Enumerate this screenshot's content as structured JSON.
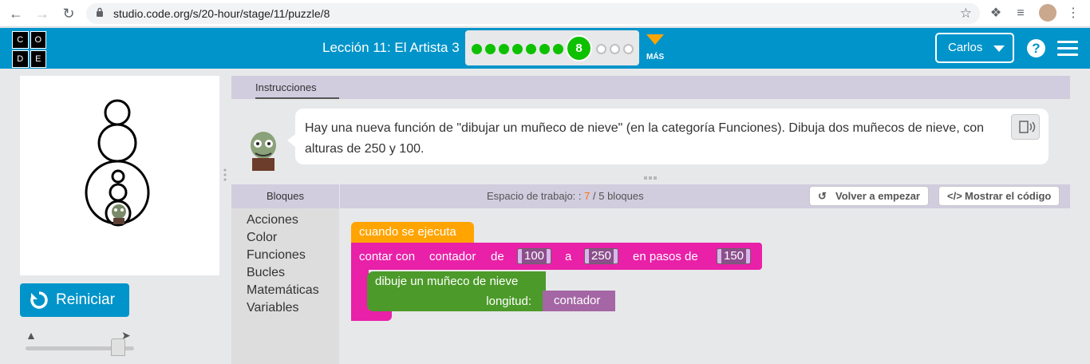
{
  "browser": {
    "url": "studio.code.org/s/20-hour/stage/11/puzzle/8"
  },
  "header": {
    "logo_letters": [
      "C",
      "O",
      "D",
      "E"
    ],
    "lesson_title": "Lección 11: El Artista 3",
    "current_puzzle": "8",
    "completed_dots": 7,
    "remaining_dots": 3,
    "more_label": "MÁS",
    "user_name": "Carlos",
    "help_label": "?"
  },
  "left_panel": {
    "reset_label": "Reiniciar",
    "speed_fraction": 0.85
  },
  "instructions": {
    "tab_label": "Instrucciones",
    "text": "Hay una nueva función de \"dibujar un muñeco de nieve\" (en la categoría Funciones). Dibuja dos muñecos de nieve, con alturas de 250 y 100."
  },
  "toolbox": {
    "header": "Bloques",
    "categories": [
      "Acciones",
      "Color",
      "Funciones",
      "Bucles",
      "Matemáticas",
      "Variables"
    ]
  },
  "workspace": {
    "title_prefix": "Espacio de trabajo: :",
    "block_count": "7",
    "block_limit": "/ 5 bloques",
    "restart_label": "Volver a empezar",
    "show_code_label": "Mostrar el código"
  },
  "blocks": {
    "hat": "cuando se ejecuta",
    "loop_word": "contar con",
    "loop_var": "contador",
    "loop_from": "de",
    "loop_from_value": "100",
    "loop_to": "a",
    "loop_to_value": "250",
    "loop_step": "en pasos de",
    "loop_step_value": "150",
    "function_name": "dibuje un muñeco de nieve",
    "function_param": "longitud:",
    "variable": "contador"
  },
  "colors": {
    "header": "#0094ca",
    "event_block": "#ffa400",
    "loop_block": "#e920a8",
    "function_block": "#4c9a2a",
    "variable_block": "#a466a4",
    "progress_green": "#0ec100"
  }
}
